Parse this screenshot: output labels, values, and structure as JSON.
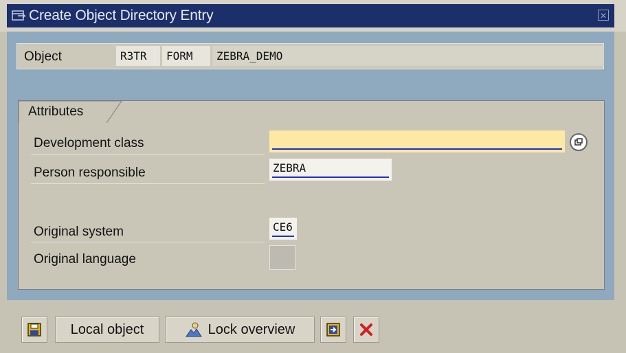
{
  "window": {
    "title": "Create Object Directory Entry",
    "title_icon": "window-icon",
    "close_icon": "close-icon"
  },
  "object": {
    "label": "Object",
    "program_id": "R3TR",
    "object_type": "FORM",
    "object_name": "ZEBRA_DEMO"
  },
  "attributes": {
    "group_title": "Attributes",
    "development_class": {
      "label": "Development class",
      "value": ""
    },
    "person_responsible": {
      "label": "Person responsible",
      "value": "ZEBRA"
    },
    "original_system": {
      "label": "Original system",
      "value": "CE6"
    },
    "original_language": {
      "label": "Original language",
      "value": ""
    }
  },
  "toolbar": {
    "save_icon": "save-icon",
    "local_object_label": "Local object",
    "lock_overview_label": "Lock overview",
    "lock_overview_icon": "lock-overview-icon",
    "other_object_icon": "other-object-icon",
    "cancel_icon": "cancel-icon"
  },
  "colors": {
    "title_bar": "#1b2f6a",
    "body_background": "#8fa9be",
    "required_field": "#fce9a4",
    "cancel_red": "#d11f1f"
  }
}
